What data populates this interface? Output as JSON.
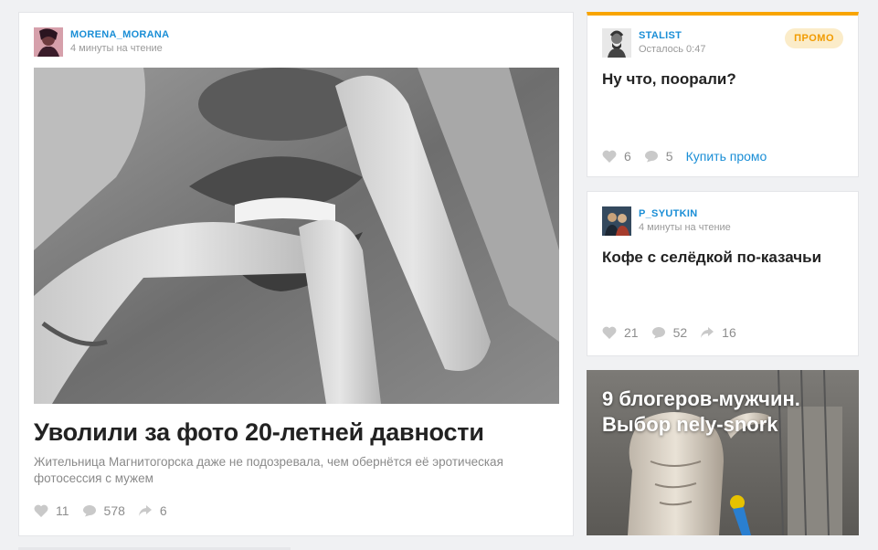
{
  "main_post": {
    "author": "MORENA_MORANA",
    "read_time": "4 минуты на чтение",
    "title": "Уволили за фото 20-летней давности",
    "lead": "Жительница Магнитогорска даже не подозревала, чем обернётся её эротическая фотосессия с мужем",
    "likes": "11",
    "comments": "578",
    "shares": "6"
  },
  "promo_post": {
    "author": "STALIST",
    "time_left": "Осталось 0:47",
    "badge": "ПРОМО",
    "title": "Ну что, поорали?",
    "likes": "6",
    "comments": "5",
    "buy_label": "Купить промо"
  },
  "coffee_post": {
    "author": "P_SYUTKIN",
    "read_time": "4 минуты на чтение",
    "title": "Кофе с селёдкой по-казачьи",
    "likes": "21",
    "comments": "52",
    "shares": "16"
  },
  "bloggers_post": {
    "title": "9 блогеров-мужчин. Выбор nely-snork"
  },
  "colors": {
    "accent_blue": "#1a8ed6",
    "promo_orange": "#f8a400",
    "background": "#f0f1f3"
  },
  "icons": {
    "like": "heart-icon",
    "comment": "speech-bubble-icon",
    "share": "share-arrow-icon"
  }
}
